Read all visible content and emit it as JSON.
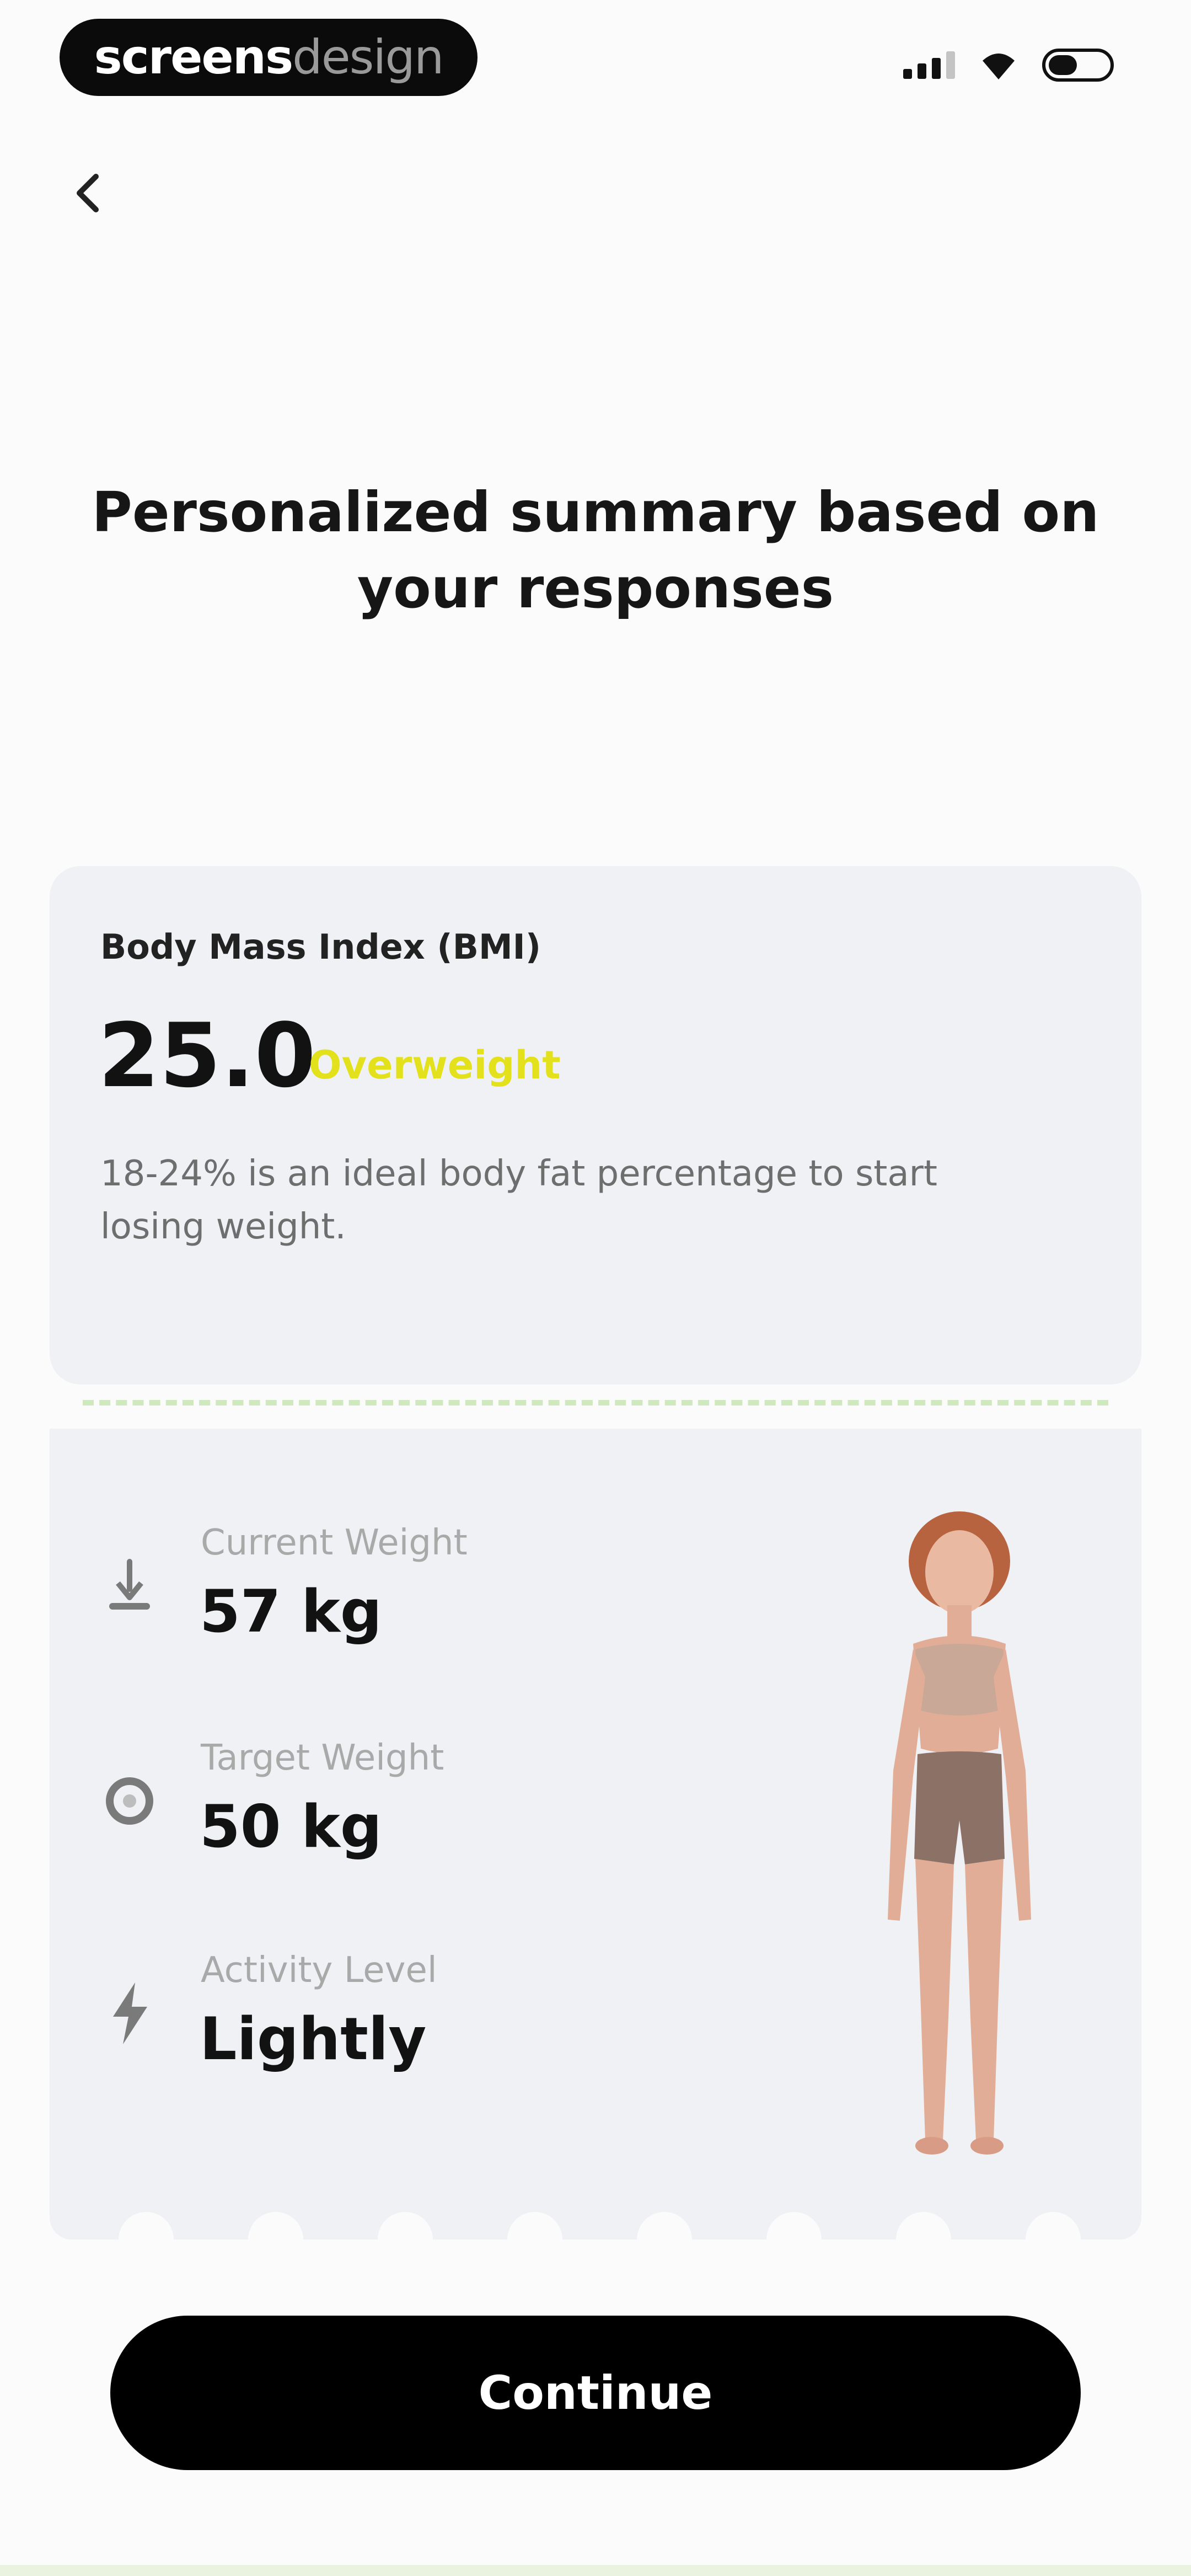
{
  "status_bar": {
    "brand_part1": "screens",
    "brand_part2": "design"
  },
  "header": {
    "back_icon": "chevron-left-icon",
    "title": "Personalized summary based on your responses"
  },
  "bmi": {
    "label": "Body Mass Index (BMI)",
    "value": "25.0",
    "status": "Overweight",
    "status_color": "#e3e11c",
    "description": "18-24% is an ideal body fat percentage to start losing weight."
  },
  "metrics": [
    {
      "icon": "scale-icon",
      "label": "Current Weight",
      "value": "57 kg"
    },
    {
      "icon": "target-icon",
      "label": "Target Weight",
      "value": "50 kg"
    },
    {
      "icon": "lightning-icon",
      "label": "Activity Level",
      "value": "Lightly"
    }
  ],
  "actions": {
    "continue_label": "Continue"
  },
  "colors": {
    "card_background": "#eff1f5",
    "dash_line": "#cfe8bd",
    "button_background": "#000000"
  }
}
